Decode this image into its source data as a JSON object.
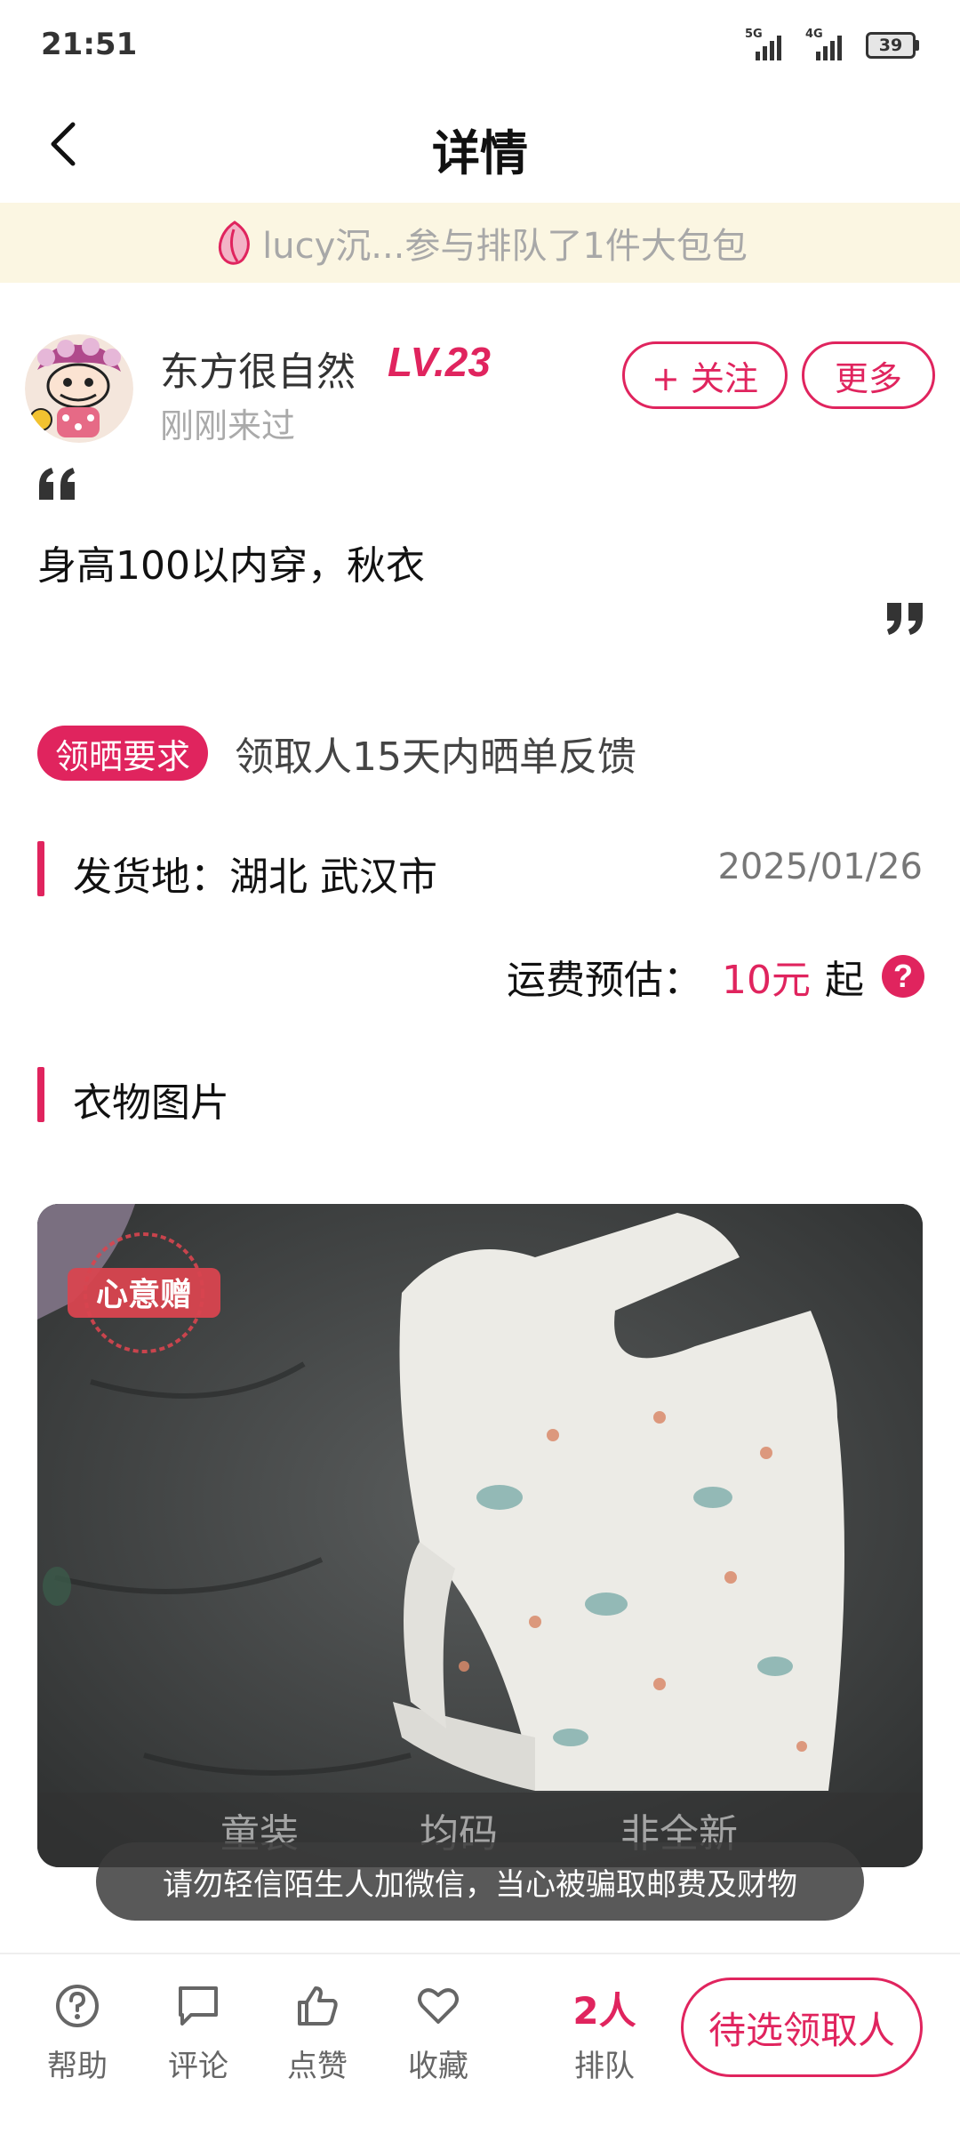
{
  "status_bar": {
    "time": "21:51",
    "network1": "5G",
    "network2": "4G",
    "battery": "39"
  },
  "header": {
    "title": "详情"
  },
  "notice": {
    "text": "lucy沉...参与排队了1件大包包"
  },
  "user": {
    "name": "东方很自然",
    "level": "LV.23",
    "last_seen": "刚刚来过",
    "follow_label": "+ 关注",
    "more_label": "更多"
  },
  "item": {
    "description": "身高100以内穿，秋衣",
    "requirement_badge": "领晒要求",
    "requirement_text": "领取人15天内晒单反馈",
    "ship_from": "发货地：湖北 武汉市",
    "date": "2025/01/26",
    "shipping_label": "运费预估：",
    "shipping_price": "10元",
    "shipping_suffix": "起"
  },
  "photos": {
    "section_title": "衣物图片",
    "stamp_text": "心意赠",
    "tags": [
      "童装",
      "均码",
      "非全新"
    ]
  },
  "toast": {
    "text": "请勿轻信陌生人加微信，当心被骗取邮费及财物"
  },
  "bottom_bar": {
    "help": "帮助",
    "comment": "评论",
    "like": "点赞",
    "favorite": "收藏",
    "queue_count": "2人",
    "queue_label": "排队",
    "claim_button": "待选领取人"
  },
  "colors": {
    "accent": "#e0245e",
    "notice_bg": "#fbf6e2"
  }
}
